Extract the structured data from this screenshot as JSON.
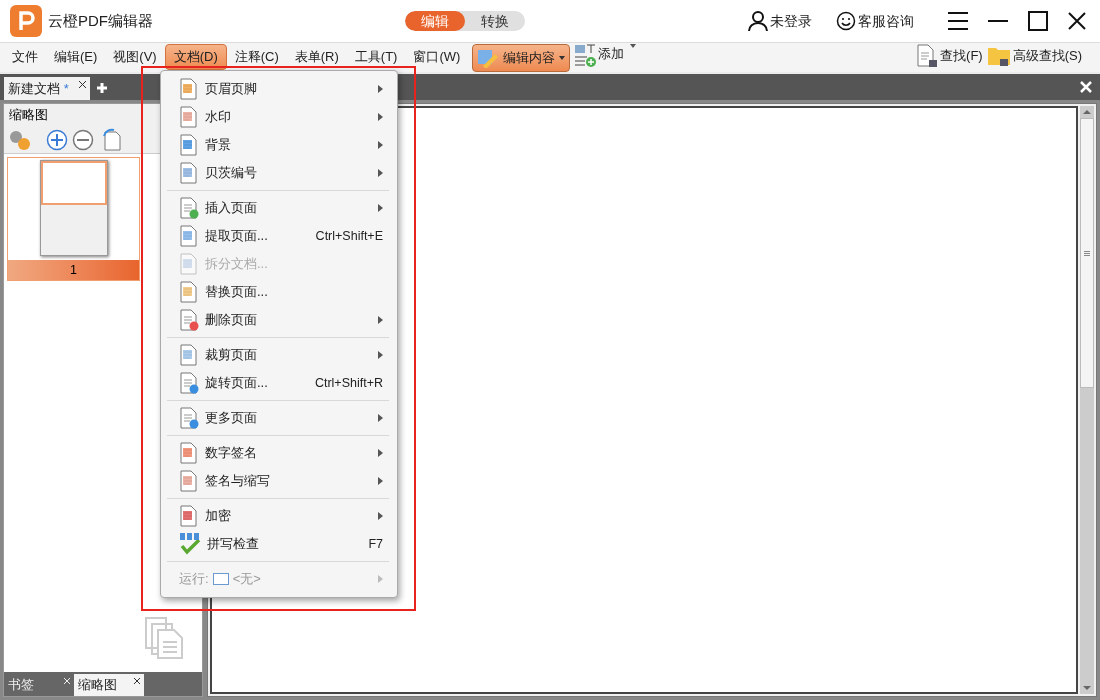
{
  "app": {
    "title": "云橙PDF编辑器"
  },
  "mode_tabs": [
    {
      "label": "编辑",
      "selected": true
    },
    {
      "label": "转换",
      "selected": false
    }
  ],
  "account": {
    "login": "未登录",
    "support": "客服咨询"
  },
  "menubar": [
    {
      "label": "文件",
      "selected": false
    },
    {
      "label": "编辑(E)",
      "selected": false
    },
    {
      "label": "视图(V)",
      "selected": false
    },
    {
      "label": "文档(D)",
      "selected": true
    },
    {
      "label": "注释(C)",
      "selected": false
    },
    {
      "label": "表单(R)",
      "selected": false
    },
    {
      "label": "工具(T)",
      "selected": false
    },
    {
      "label": "窗口(W)",
      "selected": false
    }
  ],
  "toolbar": {
    "edit_content": "编辑内容",
    "add": "添加",
    "find": "查找(F)",
    "advanced_find": "高级查找(S)"
  },
  "doc_tabs": [
    {
      "label": "新建文档",
      "modified": "*"
    }
  ],
  "thumbnail_panel": {
    "title": "缩略图",
    "page_number": "1",
    "bottom_tabs": [
      {
        "label": "书签",
        "selected": false
      },
      {
        "label": "缩略图",
        "selected": true
      }
    ]
  },
  "menu": [
    {
      "kind": "item",
      "label": "页眉页脚",
      "submenu": true,
      "disabled": false
    },
    {
      "kind": "item",
      "label": "水印",
      "submenu": true,
      "disabled": false
    },
    {
      "kind": "item",
      "label": "背景",
      "submenu": true,
      "disabled": false
    },
    {
      "kind": "item",
      "label": "贝茨编号",
      "submenu": true,
      "disabled": false
    },
    {
      "kind": "separator"
    },
    {
      "kind": "item",
      "label": "插入页面",
      "submenu": true,
      "disabled": false
    },
    {
      "kind": "item",
      "label": "提取页面...",
      "shortcut": "Ctrl+Shift+E",
      "submenu": false,
      "disabled": false
    },
    {
      "kind": "item",
      "label": "拆分文档...",
      "submenu": false,
      "disabled": true
    },
    {
      "kind": "item",
      "label": "替换页面...",
      "submenu": false,
      "disabled": false
    },
    {
      "kind": "item",
      "label": "删除页面",
      "submenu": true,
      "disabled": false
    },
    {
      "kind": "separator"
    },
    {
      "kind": "item",
      "label": "裁剪页面",
      "submenu": true,
      "disabled": false
    },
    {
      "kind": "item",
      "label": "旋转页面...",
      "shortcut": "Ctrl+Shift+R",
      "submenu": false,
      "disabled": false
    },
    {
      "kind": "separator"
    },
    {
      "kind": "item",
      "label": "更多页面",
      "submenu": true,
      "disabled": false
    },
    {
      "kind": "separator"
    },
    {
      "kind": "item",
      "label": "数字签名",
      "submenu": true,
      "disabled": false
    },
    {
      "kind": "item",
      "label": "签名与缩写",
      "submenu": true,
      "disabled": false
    },
    {
      "kind": "separator"
    },
    {
      "kind": "item",
      "label": "加密",
      "submenu": true,
      "disabled": false
    },
    {
      "kind": "item",
      "label": "拼写检查",
      "shortcut": "F7",
      "submenu": false,
      "disabled": false
    },
    {
      "kind": "separator"
    },
    {
      "kind": "run",
      "label": "运行:",
      "value": "<无>",
      "submenu": true,
      "disabled": true
    }
  ]
}
